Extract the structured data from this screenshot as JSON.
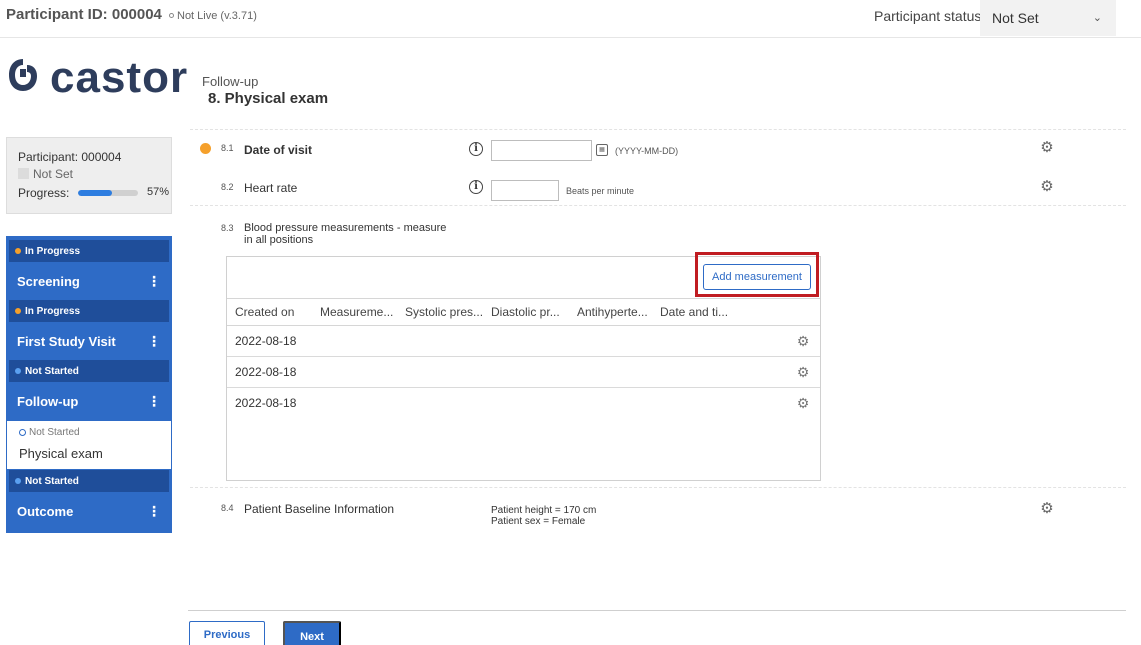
{
  "header": {
    "participant_id": "Participant ID: 000004",
    "live_status": "Not Live (v.3.71)",
    "participant_status_label": "Participant status:",
    "participant_status_value": "Not Set"
  },
  "logo": {
    "text": "castor"
  },
  "page": {
    "phase": "Follow-up",
    "title": "8. Physical exam"
  },
  "participant_box": {
    "name": "Participant: 000004",
    "state": "Not Set",
    "progress_label": "Progress:",
    "progress_value": 0.57,
    "progress_text": "57%"
  },
  "nav": {
    "steps": [
      {
        "status": "In Progress",
        "title": "Screening"
      },
      {
        "status": "In Progress",
        "title": "First Study Visit"
      },
      {
        "status": "Not Started",
        "title": "Follow-up"
      },
      {
        "status": "Not Started",
        "title": "Outcome"
      }
    ],
    "sub": {
      "status": "Not Started",
      "title": "Physical exam"
    }
  },
  "colors": {
    "in_progress": "#f5a02b",
    "not_started": "#5aa0f0",
    "brand_blue": "#2e6bc6",
    "highlight": "#c01c22"
  },
  "questions": [
    {
      "num": "8.1",
      "label": "Date of visit",
      "hint": "(YYYY-MM-DD)"
    },
    {
      "num": "8.2",
      "label": "Heart rate",
      "hint": "Beats per minute"
    },
    {
      "num": "8.3",
      "label": "Blood pressure measurements - measure in all positions",
      "label_line1": "Blood pressure measurements - measure",
      "label_line2": "in all positions"
    },
    {
      "num": "8.4",
      "label": "Patient Baseline Information"
    }
  ],
  "table": {
    "add_button": "Add measurement",
    "columns": [
      "Created on",
      "Measureme...",
      "Systolic pres...",
      "Diastolic pr...",
      "Antihyperte...",
      "Date and ti..."
    ],
    "rows": [
      "2022-08-18",
      "2022-08-18",
      "2022-08-18"
    ]
  },
  "baseline": {
    "height": "Patient height = 170 cm",
    "sex": "Patient sex = Female"
  },
  "footer": {
    "previous": "Previous",
    "next": "Next"
  }
}
